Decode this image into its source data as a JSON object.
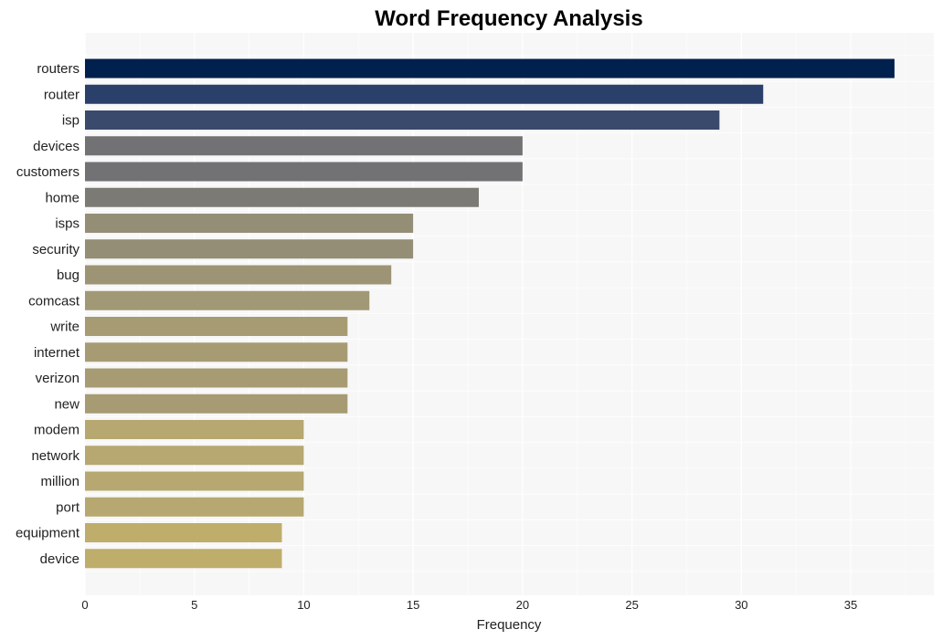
{
  "chart_data": {
    "type": "bar",
    "orientation": "horizontal",
    "title": "Word Frequency Analysis",
    "xlabel": "Frequency",
    "ylabel": "",
    "xlim": [
      0,
      38.8
    ],
    "xticks": [
      0,
      5,
      10,
      15,
      20,
      25,
      30,
      35
    ],
    "grid": true,
    "categories": [
      "routers",
      "router",
      "isp",
      "devices",
      "customers",
      "home",
      "isps",
      "security",
      "bug",
      "comcast",
      "write",
      "internet",
      "verizon",
      "new",
      "modem",
      "network",
      "million",
      "port",
      "equipment",
      "device"
    ],
    "values": [
      37,
      31,
      29,
      20,
      20,
      18,
      15,
      15,
      14,
      13,
      12,
      12,
      12,
      12,
      10,
      10,
      10,
      10,
      9,
      9
    ],
    "colors": [
      "#00204e",
      "#2a3f6a",
      "#3a4a6d",
      "#727274",
      "#727274",
      "#7b7a75",
      "#948e77",
      "#948e77",
      "#9d9475",
      "#a19875",
      "#a69b73",
      "#a69b73",
      "#a69b73",
      "#a69b73",
      "#b6a870",
      "#b6a870",
      "#b6a870",
      "#b6a870",
      "#bfad6c",
      "#bfad6c"
    ],
    "background": "#f7f7f7"
  }
}
